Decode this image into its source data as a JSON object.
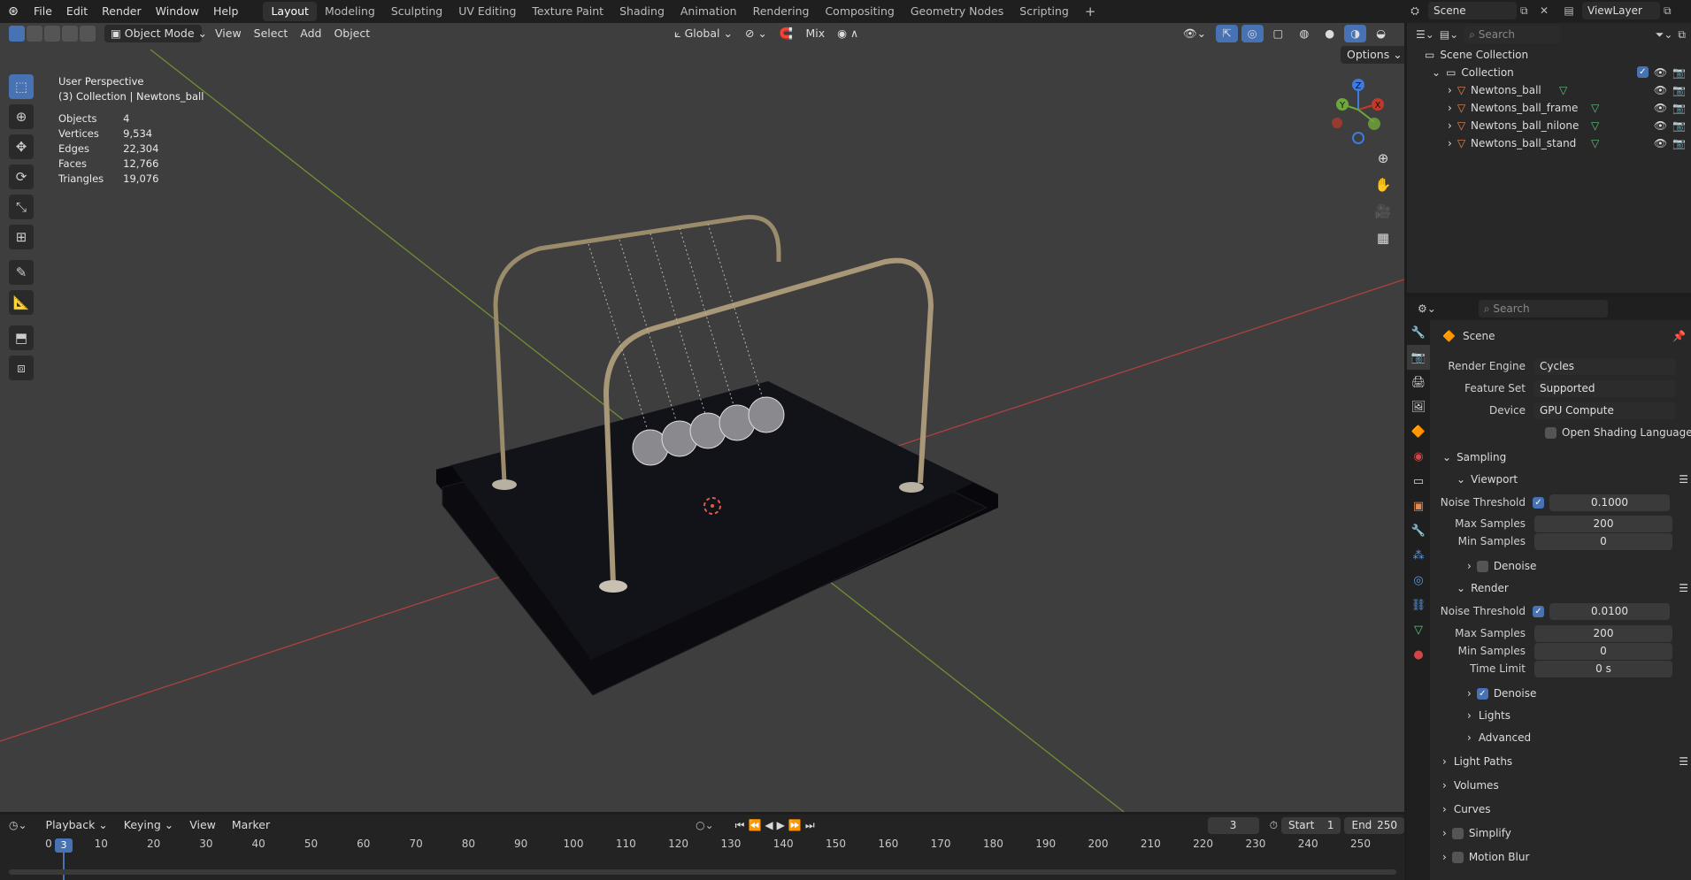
{
  "topbar": {
    "menus": [
      "File",
      "Edit",
      "Render",
      "Window",
      "Help"
    ],
    "workspaces": [
      "Layout",
      "Modeling",
      "Sculpting",
      "UV Editing",
      "Texture Paint",
      "Shading",
      "Animation",
      "Rendering",
      "Compositing",
      "Geometry Nodes",
      "Scripting"
    ],
    "active_workspace": "Layout",
    "add_tab": "+",
    "scene": "Scene",
    "view_layer": "ViewLayer"
  },
  "viewport_header": {
    "mode": "Object Mode",
    "menus": [
      "View",
      "Select",
      "Add",
      "Object"
    ],
    "transform_orientation": "Global",
    "snap_mode": "Mix",
    "options": "Options"
  },
  "overlay": {
    "perspective": "User Perspective",
    "collection": "(3) Collection | Newtons_ball",
    "stats": [
      {
        "label": "Objects",
        "value": "4"
      },
      {
        "label": "Vertices",
        "value": "9,534"
      },
      {
        "label": "Edges",
        "value": "22,304"
      },
      {
        "label": "Faces",
        "value": "12,766"
      },
      {
        "label": "Triangles",
        "value": "19,076"
      }
    ]
  },
  "gizmo": {
    "x": "X",
    "y": "Y",
    "z": "Z"
  },
  "outliner": {
    "search_placeholder": "Search",
    "scene_collection": "Scene Collection",
    "collection": "Collection",
    "objects": [
      "Newtons_ball",
      "Newtons_ball_frame",
      "Newtons_ball_nilone",
      "Newtons_ball_stand"
    ]
  },
  "properties": {
    "search_placeholder": "Search",
    "context": "Scene",
    "render_engine_label": "Render Engine",
    "render_engine": "Cycles",
    "feature_set_label": "Feature Set",
    "feature_set": "Supported",
    "device_label": "Device",
    "device": "GPU Compute",
    "osl_label": "Open Shading Language",
    "sampling": "Sampling",
    "viewport": "Viewport",
    "vp_noise_label": "Noise Threshold",
    "vp_noise": "0.1000",
    "vp_max_label": "Max Samples",
    "vp_max": "200",
    "vp_min_label": "Min Samples",
    "vp_min": "0",
    "vp_denoise": "Denoise",
    "render": "Render",
    "r_noise_label": "Noise Threshold",
    "r_noise": "0.0100",
    "r_max_label": "Max Samples",
    "r_max": "200",
    "r_min_label": "Min Samples",
    "r_min": "0",
    "r_time_label": "Time Limit",
    "r_time": "0 s",
    "r_denoise": "Denoise",
    "lights": "Lights",
    "advanced": "Advanced",
    "light_paths": "Light Paths",
    "volumes": "Volumes",
    "curves": "Curves",
    "simplify": "Simplify",
    "motion_blur": "Motion Blur"
  },
  "timeline": {
    "menus": [
      "Playback",
      "Keying",
      "View",
      "Marker"
    ],
    "current_frame": "3",
    "start_label": "Start",
    "start": "1",
    "end_label": "End",
    "end": "250",
    "ticks": [
      "0",
      "10",
      "20",
      "30",
      "40",
      "50",
      "60",
      "70",
      "80",
      "90",
      "100",
      "110",
      "120",
      "130",
      "140",
      "150",
      "160",
      "170",
      "180",
      "190",
      "200",
      "210",
      "220",
      "230",
      "240",
      "250"
    ]
  },
  "colors": {
    "accent": "#4772b3",
    "x_axis": "#c0392b",
    "y_axis": "#6fa83a",
    "z_axis": "#3d7be0",
    "header": "#1f1f1f",
    "viewport": "#3e3e3e"
  }
}
